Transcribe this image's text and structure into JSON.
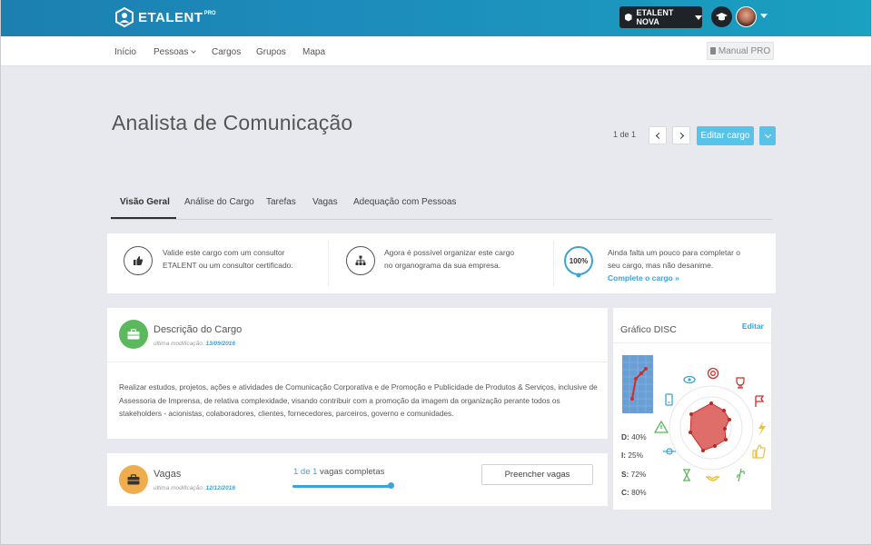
{
  "brand": {
    "name": "ETALENT",
    "sup": "PRO"
  },
  "topbar": {
    "company_label": "ETALENT NOVA"
  },
  "nav": {
    "items": [
      "Início",
      "Pessoas",
      "Cargos",
      "Grupos",
      "Mapa"
    ],
    "manual_label": "Manual PRO"
  },
  "page": {
    "title": "Analista de Comunicação",
    "pager": "1 de 1",
    "edit_label": "Editar cargo"
  },
  "tabs": [
    "Visão Geral",
    "Análise do Cargo",
    "Tarefas",
    "Vagas",
    "Adequação com Pessoas"
  ],
  "info": {
    "col1": {
      "line1": "Valide este cargo com um consultor",
      "line2": "ETALENT ou um consultor certificado."
    },
    "col2": {
      "line1": "Agora é possível organizar este cargo",
      "line2": "no organograma da sua empresa."
    },
    "col3": {
      "percent": "100%",
      "line1": "Ainda falta um pouco para completar o",
      "line2": "seu cargo, mas não desanime.",
      "link": "Complete o cargo »"
    }
  },
  "description": {
    "title": "Descrição do Cargo",
    "modified_label": "última modificação:",
    "modified_date": "13/09/2016",
    "body": "Realizar estudos, projetos, ações e atividades de Comunicação Corporativa e de Promoção e Publicidade de Produtos & Serviços, inclusive de Assessoria de Imprensa, de relativa complexidade, visando contribuir com a promoção da imagem da organização perante todos os stakeholders - acionistas, colaboradores, clientes, fornecedores, parceiros, governo e comunidades."
  },
  "vagas": {
    "title": "Vagas",
    "modified_label": "última modificação:",
    "modified_date": "12/12/2016",
    "progress_count": "1 de 1",
    "progress_text": " vagas completas",
    "progress_fraction": 1.0,
    "button": "Preencher vagas"
  },
  "disc": {
    "title": "Gráfico DISC",
    "edit": "Editar",
    "stats": [
      {
        "key": "D:",
        "value": "40%"
      },
      {
        "key": "I:",
        "value": "25%"
      },
      {
        "key": "S:",
        "value": "72%"
      },
      {
        "key": "C:",
        "value": "80%"
      }
    ]
  },
  "colors": {
    "accent": "#58c3e8",
    "link": "#3aa4d6",
    "desc_icon": "#5cb85c",
    "vagas_icon": "#f0ad4e",
    "radar": "#d9534f"
  }
}
